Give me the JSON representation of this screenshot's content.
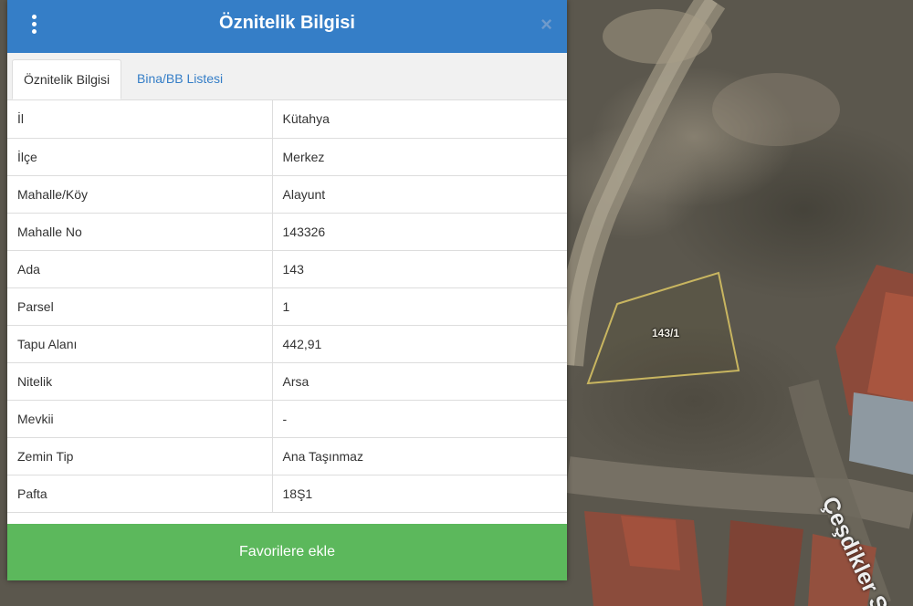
{
  "panel": {
    "title": "Öznitelik Bilgisi",
    "menu_icon": "kebab-menu-icon",
    "close_label": "×",
    "tabs": [
      {
        "label": "Öznitelik Bilgisi",
        "active": true
      },
      {
        "label": "Bina/BB Listesi",
        "active": false
      }
    ],
    "rows": [
      {
        "key": "İl",
        "value": "Kütahya"
      },
      {
        "key": "İlçe",
        "value": "Merkez"
      },
      {
        "key": "Mahalle/Köy",
        "value": "Alayunt"
      },
      {
        "key": "Mahalle No",
        "value": "143326"
      },
      {
        "key": "Ada",
        "value": "143"
      },
      {
        "key": "Parsel",
        "value": "1"
      },
      {
        "key": "Tapu Alanı",
        "value": "442,91"
      },
      {
        "key": "Nitelik",
        "value": "Arsa"
      },
      {
        "key": "Mevkii",
        "value": "-"
      },
      {
        "key": "Zemin Tip",
        "value": "Ana Taşınmaz"
      },
      {
        "key": "Pafta",
        "value": "18Ş1"
      }
    ],
    "favorite_button": "Favorilere ekle"
  },
  "map": {
    "parcel_label": "143/1",
    "street_label": "Çeşdikler S"
  },
  "colors": {
    "header": "#357ec7",
    "button": "#5cb85c",
    "parcel_outline": "#c8b560"
  }
}
